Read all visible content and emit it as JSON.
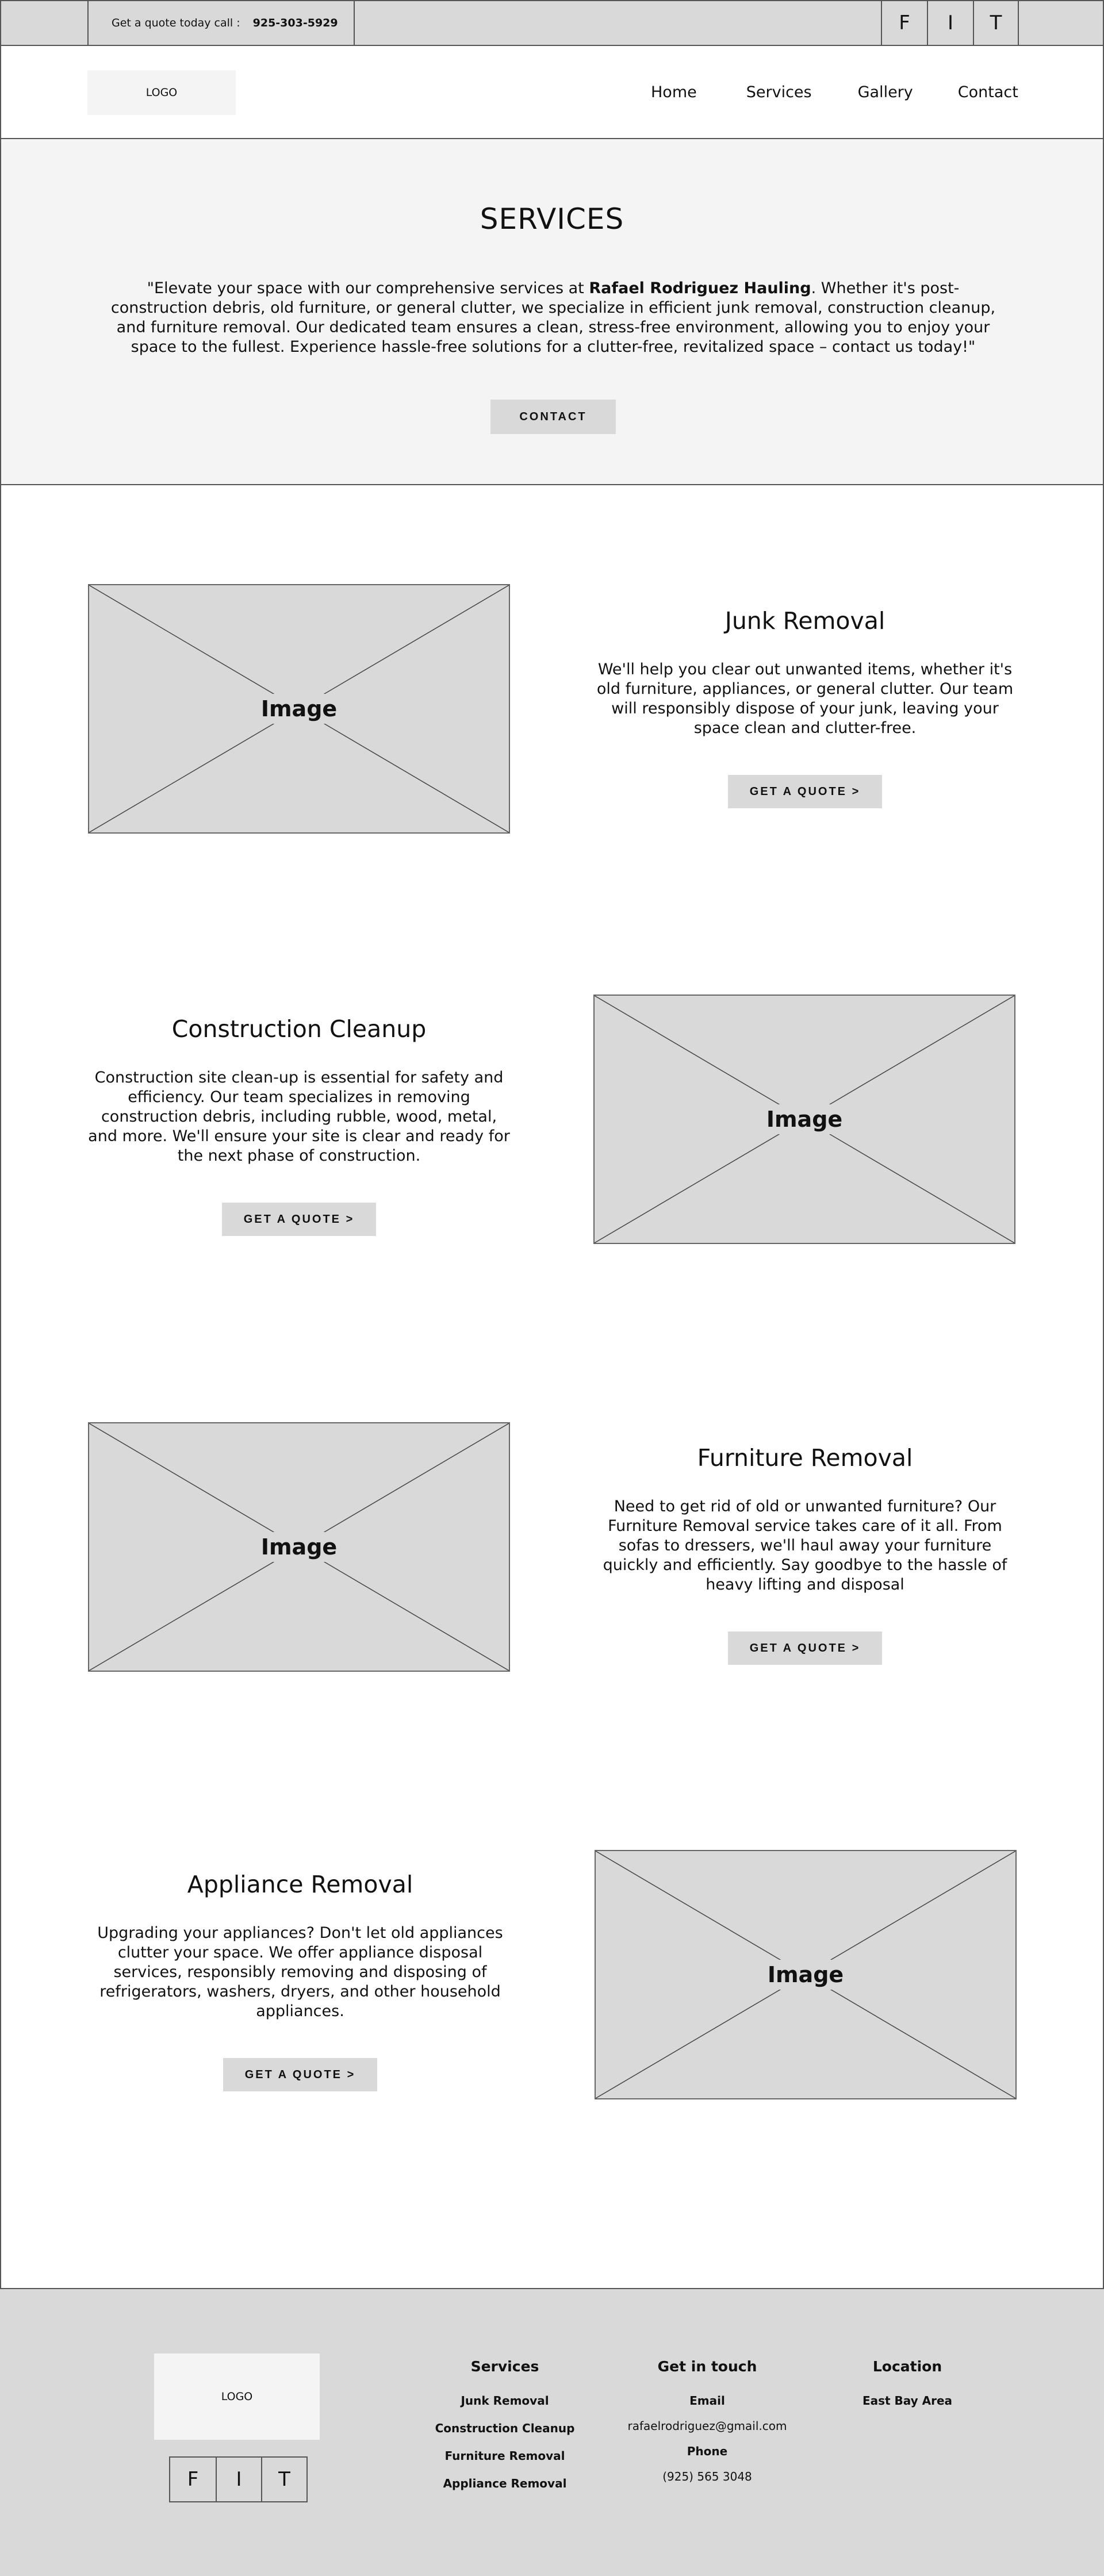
{
  "topbar": {
    "call_text": "Get a quote today call :",
    "phone": "925-303-5929",
    "social": [
      "F",
      "I",
      "T"
    ]
  },
  "nav": {
    "logo": "LOGO",
    "links": [
      "Home",
      "Services",
      "Gallery",
      "Contact"
    ]
  },
  "hero": {
    "title": "SERVICES",
    "text_before": "\"Elevate your space with our comprehensive services at ",
    "company": "Rafael Rodriguez Hauling",
    "text_after": ". Whether it's post-construction debris, old furniture, or general clutter, we specialize in efficient junk removal, construction cleanup, and furniture removal. Our dedicated team ensures a clean, stress-free environment, allowing you to enjoy your space to the fullest. Experience hassle-free solutions for a clutter-free, revitalized space – contact us today!\"",
    "button": "CONTACT"
  },
  "services": [
    {
      "title": "Junk Removal",
      "description": "We'll help you clear out unwanted items, whether it's old furniture, appliances, or general clutter. Our team will responsibly dispose of your junk, leaving your space clean and clutter-free.",
      "button": "GET A QUOTE >",
      "image_label": "Image"
    },
    {
      "title": "Construction Cleanup",
      "description": "Construction site clean-up is essential for safety and efficiency. Our team specializes in removing construction debris, including rubble, wood, metal, and more. We'll ensure your site is clear and ready for the next phase of construction.",
      "button": "GET A QUOTE >",
      "image_label": "Image"
    },
    {
      "title": "Furniture Removal",
      "description": "Need to get rid of old or unwanted furniture? Our Furniture Removal service takes care of it all. From sofas to dressers, we'll haul away your furniture quickly and efficiently. Say goodbye to the hassle of heavy lifting and disposal",
      "button": "GET A QUOTE >",
      "image_label": "Image"
    },
    {
      "title": "Appliance Removal",
      "description": "Upgrading your appliances? Don't let old appliances clutter your space. We offer appliance disposal services, responsibly removing and disposing of refrigerators, washers, dryers, and other household appliances.",
      "button": "GET A QUOTE >",
      "image_label": "Image"
    }
  ],
  "footer": {
    "logo": "LOGO",
    "social": [
      "F",
      "I",
      "T"
    ],
    "services_heading": "Services",
    "services_items": [
      "Junk Removal",
      "Construction Cleanup",
      "Furniture Removal",
      "Appliance Removal"
    ],
    "contact_heading": "Get in touch",
    "email_label": "Email",
    "email": "rafaelrodriguez@gmail.com",
    "phone_label": "Phone",
    "phone": "(925) 565 3048",
    "location_heading": "Location",
    "location": "East Bay Area"
  }
}
